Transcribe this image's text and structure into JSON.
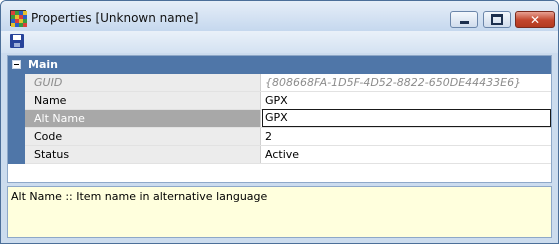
{
  "window": {
    "title": "Properties [Unknown name]"
  },
  "toolbar": {
    "save_label": ""
  },
  "grid": {
    "category": "Main",
    "rows": [
      {
        "name": "GUID",
        "value": "{808668FA-1D5F-4D52-8822-650DE44433E6}",
        "readonly": true
      },
      {
        "name": "Name",
        "value": "GPX"
      },
      {
        "name": "Alt Name",
        "value": "GPX",
        "selected": true
      },
      {
        "name": "Code",
        "value": "2"
      },
      {
        "name": "Status",
        "value": "Active"
      }
    ]
  },
  "description": {
    "text": "Alt Name :: Item name in alternative language"
  },
  "colors": {
    "titlebar": "#c5d8ee",
    "category_bar": "#4f76a8",
    "close_button": "#c2452c",
    "description_bg": "#ffffdd"
  }
}
